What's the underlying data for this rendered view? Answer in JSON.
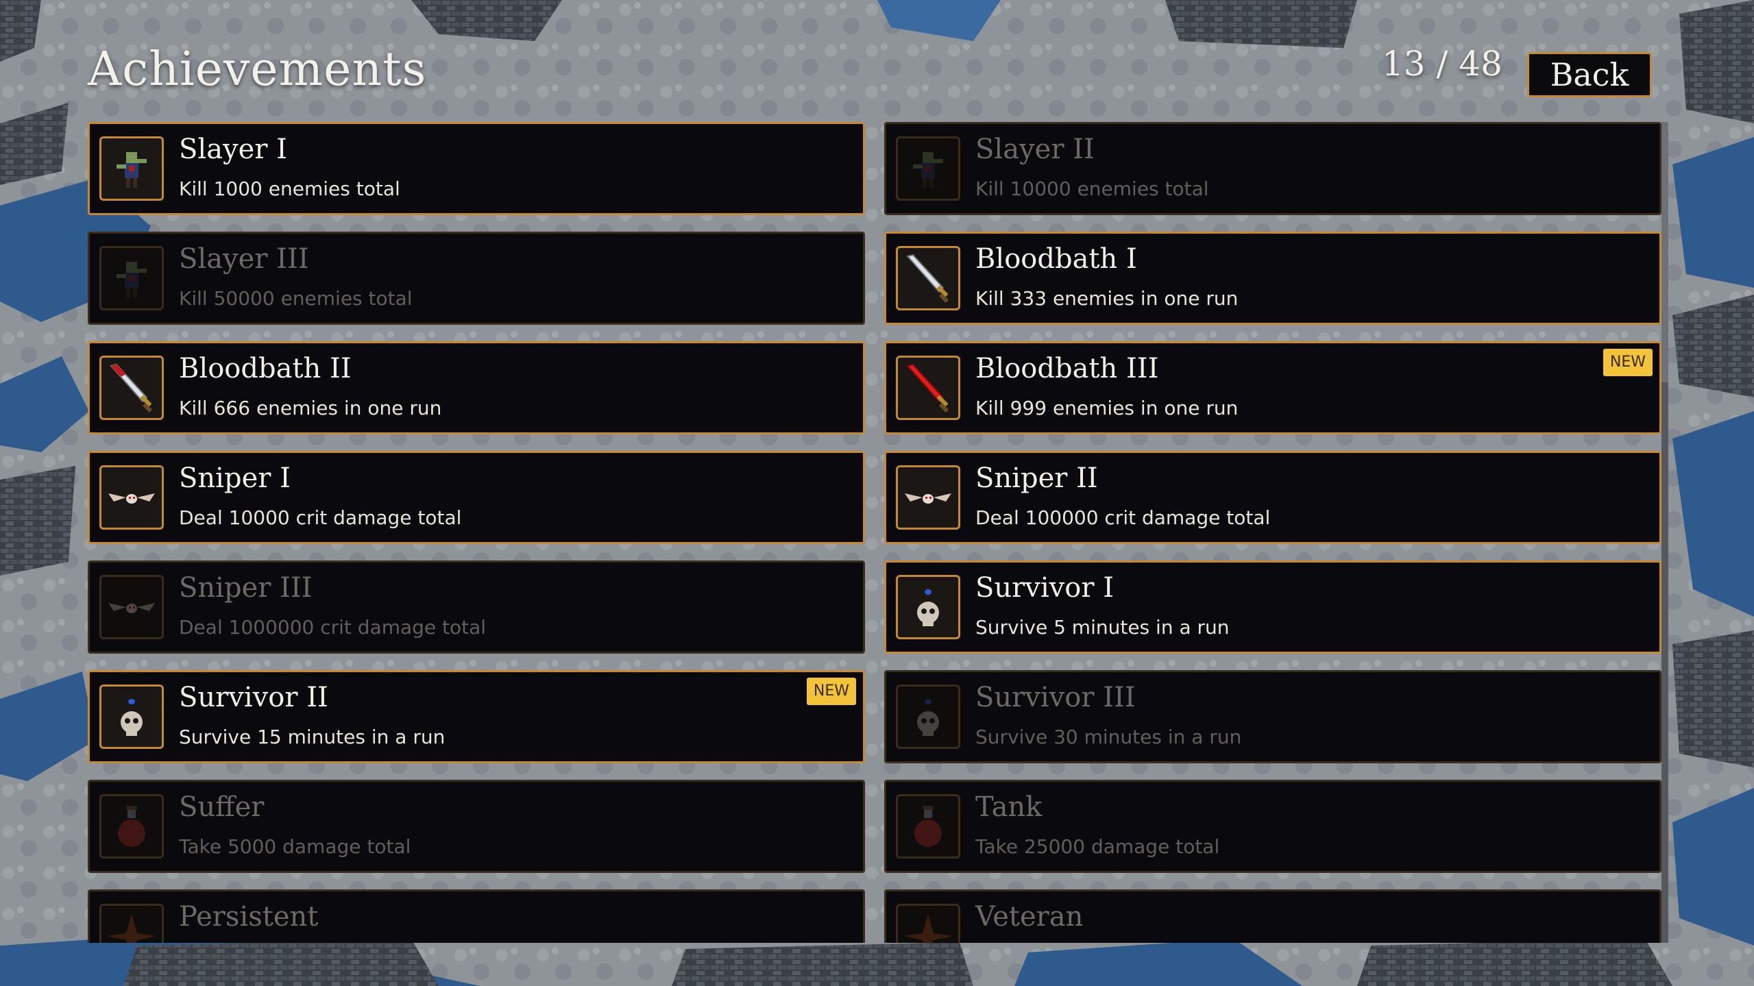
{
  "title": "Achievements",
  "progress": {
    "label": "13 / 48",
    "unlocked": 13,
    "total": 48
  },
  "back_label": "Back",
  "achievements": [
    {
      "id": "slayer-1",
      "name": "Slayer I",
      "desc": "Kill 1000 enemies total",
      "unlocked": true,
      "icon": "zombie-icon"
    },
    {
      "id": "slayer-2",
      "name": "Slayer II",
      "desc": "Kill 10000 enemies total",
      "unlocked": false,
      "icon": "zombie-icon"
    },
    {
      "id": "slayer-3",
      "name": "Slayer III",
      "desc": "Kill 50000 enemies total",
      "unlocked": false,
      "icon": "zombie-icon"
    },
    {
      "id": "bloodbath-1",
      "name": "Bloodbath I",
      "desc": "Kill 333 enemies in one run",
      "unlocked": true,
      "icon": "sword-icon"
    },
    {
      "id": "bloodbath-2",
      "name": "Bloodbath II",
      "desc": "Kill 666 enemies in one run",
      "unlocked": true,
      "icon": "bloody-sword-icon"
    },
    {
      "id": "bloodbath-3",
      "name": "Bloodbath III",
      "desc": "Kill 999 enemies in one run",
      "unlocked": true,
      "icon": "red-sword-icon",
      "badge": "NEW"
    },
    {
      "id": "sniper-1",
      "name": "Sniper I",
      "desc": "Deal 10000 crit damage total",
      "unlocked": true,
      "icon": "bat-icon"
    },
    {
      "id": "sniper-2",
      "name": "Sniper II",
      "desc": "Deal 100000 crit damage total",
      "unlocked": true,
      "icon": "bat-icon"
    },
    {
      "id": "sniper-3",
      "name": "Sniper III",
      "desc": "Deal 1000000 crit damage total",
      "unlocked": false,
      "icon": "bat-icon"
    },
    {
      "id": "survivor-1",
      "name": "Survivor I",
      "desc": "Survive 5 minutes in a run",
      "unlocked": true,
      "icon": "skull-icon"
    },
    {
      "id": "survivor-2",
      "name": "Survivor II",
      "desc": "Survive 15 minutes in a run",
      "unlocked": true,
      "icon": "skull-icon",
      "badge": "NEW"
    },
    {
      "id": "survivor-3",
      "name": "Survivor III",
      "desc": "Survive 30 minutes in a run",
      "unlocked": false,
      "icon": "skull-icon"
    },
    {
      "id": "suffer",
      "name": "Suffer",
      "desc": "Take 5000 damage total",
      "unlocked": false,
      "icon": "potion-icon"
    },
    {
      "id": "tank",
      "name": "Tank",
      "desc": "Take 25000 damage total",
      "unlocked": false,
      "icon": "potion-icon"
    },
    {
      "id": "persistent",
      "name": "Persistent",
      "desc": "",
      "unlocked": false,
      "icon": "star-emblem-icon"
    },
    {
      "id": "veteran",
      "name": "Veteran",
      "desc": "",
      "unlocked": false,
      "icon": "star-emblem-icon"
    }
  ],
  "colors": {
    "accent_border": "#c68a2e",
    "card_bg": "#0a0a0e",
    "new_badge": "#f3c338",
    "water": "#2e5a8e",
    "ground": "#8c9196"
  }
}
